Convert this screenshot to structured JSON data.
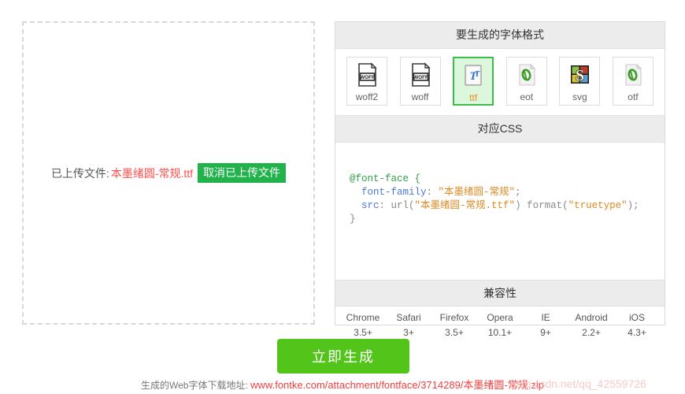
{
  "upload": {
    "label": "已上传文件:",
    "filename": "本墨绪圆-常规.ttf",
    "cancel_button": "取消已上传文件",
    "cancel_color": "#22b24c",
    "filename_color": "#ff4d4d"
  },
  "formats": {
    "header": "要生成的字体格式",
    "items": [
      {
        "label": "woff2",
        "icon": "woff-file-icon",
        "selected": false
      },
      {
        "label": "woff",
        "icon": "woff-file-icon",
        "selected": false
      },
      {
        "label": "ttf",
        "icon": "truetype-file-icon",
        "selected": true
      },
      {
        "label": "eot",
        "icon": "opentype-file-icon",
        "selected": false
      },
      {
        "label": "svg",
        "icon": "svg-file-icon",
        "selected": false
      },
      {
        "label": "otf",
        "icon": "opentype-file-icon",
        "selected": false
      }
    ],
    "selected_color": "#3bbd4e",
    "selected_bg": "#ddf7dd",
    "selected_label_color": "#ec8b1e"
  },
  "css": {
    "header": "对应CSS",
    "line1": "@font-face {",
    "line2_prop": "font-family",
    "line2_value": "\"本墨绪圆-常规\"",
    "line3_prop": "src",
    "line3_url": "\"本墨绪圆-常规.ttf\"",
    "line3_format": "\"truetype\"",
    "line4": "}"
  },
  "compat": {
    "header": "兼容性",
    "columns": [
      {
        "name": "Chrome",
        "version": "3.5+"
      },
      {
        "name": "Safari",
        "version": "3+"
      },
      {
        "name": "Firefox",
        "version": "3.5+"
      },
      {
        "name": "Opera",
        "version": "10.1+"
      },
      {
        "name": "IE",
        "version": "9+"
      },
      {
        "name": "Android",
        "version": "2.2+"
      },
      {
        "name": "iOS",
        "version": "4.3+"
      }
    ]
  },
  "actions": {
    "generate_button": "立即生成",
    "generate_color": "#52c41a"
  },
  "download": {
    "label": "生成的Web字体下载地址:",
    "url": "www.fontke.com/attachment/fontface/3714289/本墨绪圆-常规.zip",
    "url_color": "#f04040"
  },
  "watermark": {
    "text": "blog.csdn.net/qq_42559726"
  }
}
